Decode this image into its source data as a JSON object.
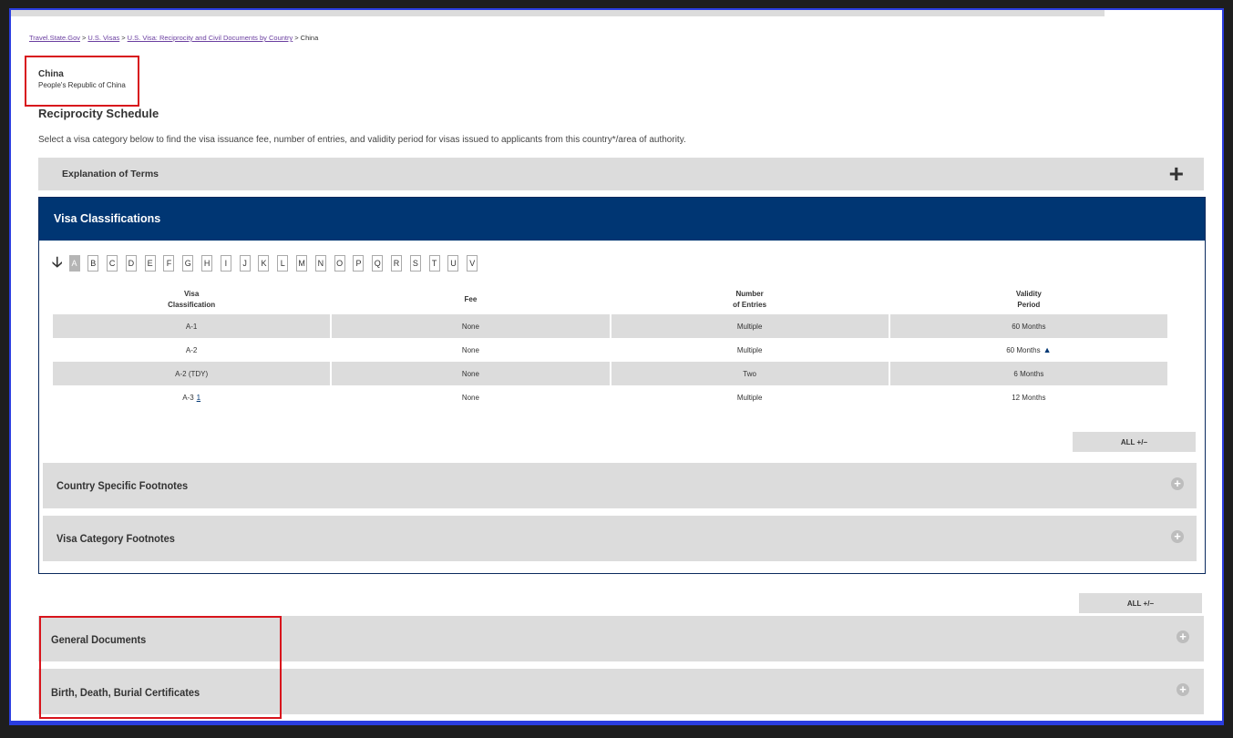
{
  "breadcrumb": {
    "items": [
      "Travel.State.Gov",
      "U.S. Visas",
      "U.S. Visa: Reciprocity and Civil Documents by Country"
    ],
    "current": "China",
    "separator": ">"
  },
  "country": {
    "name": "China",
    "full_name": "People's Republic of China"
  },
  "section_title": "Reciprocity Schedule",
  "intro_text": "Select a visa category below to find the visa issuance fee, number of entries, and validity period for visas issued to applicants from this country*/area of authority.",
  "explanation": {
    "label": "Explanation of Terms",
    "icon": "plus-icon"
  },
  "visa_panel": {
    "title": "Visa Classifications",
    "alphabet": [
      "A",
      "B",
      "C",
      "D",
      "E",
      "F",
      "G",
      "H",
      "I",
      "J",
      "K",
      "L",
      "M",
      "N",
      "O",
      "P",
      "Q",
      "R",
      "S",
      "T",
      "U",
      "V"
    ],
    "active_letter": "A",
    "columns": [
      {
        "line1": "Visa",
        "line2": "Classification"
      },
      {
        "line1": "",
        "line2": "Fee"
      },
      {
        "line1": "Number",
        "line2": "of Entries"
      },
      {
        "line1": "Validity",
        "line2": "Period"
      }
    ],
    "rows": [
      {
        "classification": "A-1",
        "footnote": "",
        "fee": "None",
        "entries": "Multiple",
        "validity": "60 Months",
        "validity_marker": ""
      },
      {
        "classification": "A-2",
        "footnote": "",
        "fee": "None",
        "entries": "Multiple",
        "validity": "60 Months",
        "validity_marker": "▲"
      },
      {
        "classification": "A-2 (TDY)",
        "footnote": "",
        "fee": "None",
        "entries": "Two",
        "validity": "6 Months",
        "validity_marker": ""
      },
      {
        "classification": "A-3",
        "footnote": "1",
        "fee": "None",
        "entries": "Multiple",
        "validity": "12 Months",
        "validity_marker": ""
      }
    ],
    "all_toggle": "ALL +/−",
    "accordions": [
      {
        "label": "Country Specific Footnotes"
      },
      {
        "label": "Visa Category Footnotes"
      }
    ]
  },
  "documents": {
    "all_toggle": "ALL +/−",
    "accordions": [
      {
        "label": "General Documents"
      },
      {
        "label": "Birth, Death, Burial Certificates"
      }
    ]
  },
  "colors": {
    "header_blue": "#003673",
    "highlight_red": "#d8141c",
    "bar_gray": "#dcdcdc"
  }
}
